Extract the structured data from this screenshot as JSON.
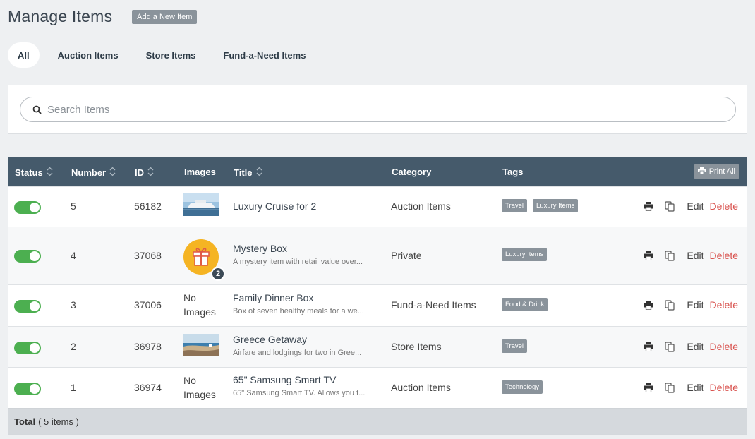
{
  "header": {
    "title": "Manage Items",
    "add_button": "Add a New Item"
  },
  "tabs": [
    {
      "label": "All",
      "active": true
    },
    {
      "label": "Auction Items"
    },
    {
      "label": "Store Items"
    },
    {
      "label": "Fund-a-Need Items"
    }
  ],
  "search": {
    "placeholder": "Search Items",
    "value": ""
  },
  "table": {
    "columns": {
      "status": "Status",
      "number": "Number",
      "id": "ID",
      "images": "Images",
      "title": "Title",
      "category": "Category",
      "tags": "Tags"
    },
    "print_all": "Print All",
    "rows": [
      {
        "status": "on",
        "number": "5",
        "id": "56182",
        "image": "cruise-photo",
        "title": "Luxury Cruise for 2",
        "subtitle": "",
        "category": "Auction Items",
        "tags": [
          "Travel",
          "Luxury Items"
        ],
        "edit": "Edit",
        "delete": "Delete"
      },
      {
        "status": "on",
        "number": "4",
        "id": "37068",
        "image": "gift-icon",
        "image_count": "2",
        "title": "Mystery Box",
        "subtitle": "A mystery item with retail value over...",
        "category": "Private",
        "tags": [
          "Luxury Items"
        ],
        "edit": "Edit",
        "delete": "Delete"
      },
      {
        "status": "on",
        "number": "3",
        "id": "37006",
        "image_text": "No Images",
        "title": "Family Dinner Box",
        "subtitle": "Box of seven healthy meals for a we...",
        "category": "Fund-a-Need Items",
        "tags": [
          "Food & Drink"
        ],
        "edit": "Edit",
        "delete": "Delete"
      },
      {
        "status": "on",
        "number": "2",
        "id": "36978",
        "image": "greece-photo",
        "title": "Greece Getaway",
        "subtitle": "Airfare and lodgings for two in Gree...",
        "category": "Store Items",
        "tags": [
          "Travel"
        ],
        "edit": "Edit",
        "delete": "Delete"
      },
      {
        "status": "on",
        "number": "1",
        "id": "36974",
        "image_text": "No Images",
        "title": "65\" Samsung Smart TV",
        "subtitle": "65\" Samsung Smart TV. Allows you t...",
        "category": "Auction Items",
        "tags": [
          "Technology"
        ],
        "edit": "Edit",
        "delete": "Delete"
      }
    ],
    "footer": {
      "label": "Total",
      "count": "( 5 items )"
    }
  },
  "colors": {
    "accent_header": "#455a6b",
    "toggle_on": "#4caf50",
    "delete": "#d9534f",
    "tag_bg": "#8a939b"
  }
}
